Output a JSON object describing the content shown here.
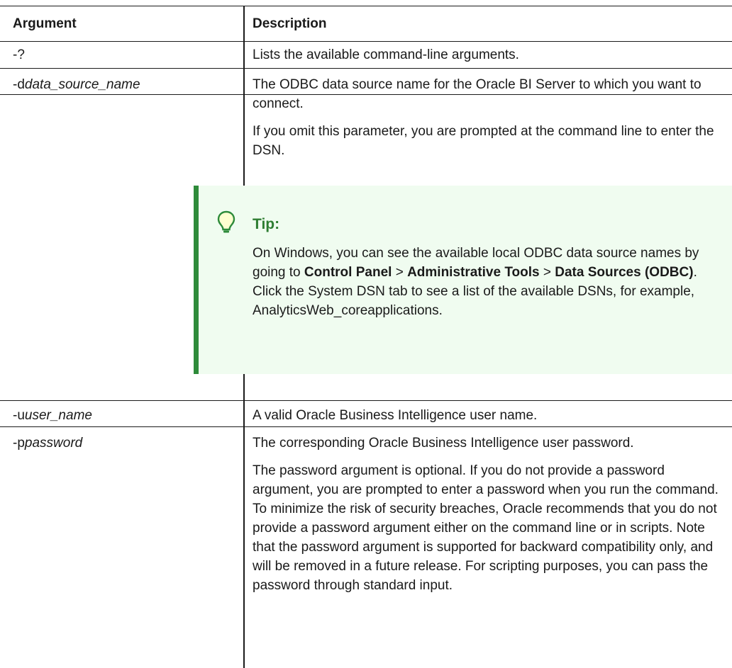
{
  "table": {
    "headers": {
      "argument": "Argument",
      "description": "Description"
    },
    "rows": [
      {
        "arg_prefix": "-?",
        "arg_italic": "",
        "desc": [
          "Lists the available command-line arguments."
        ]
      },
      {
        "arg_prefix": "-d",
        "arg_italic": "data_source_name",
        "desc": [
          "The ODBC data source name for the Oracle BI Server to which you want to connect.",
          "If you omit this parameter, you are prompted at the command line to enter the DSN."
        ]
      },
      {
        "arg_prefix": "-u",
        "arg_italic": "user_name",
        "desc": [
          "A valid Oracle Business Intelligence user name."
        ]
      },
      {
        "arg_prefix": "-p",
        "arg_italic": "password",
        "desc": [
          "The corresponding Oracle Business Intelligence user password.",
          "The password argument is optional. If you do not provide a password argument, you are prompted to enter a password when you run the command. To minimize the risk of security breaches, Oracle recommends that you do not provide a password argument either on the command line or in scripts. Note that the password argument is supported for backward compatibility only, and will be removed in a future release. For scripting purposes, you can pass the password through standard input."
        ]
      }
    ]
  },
  "tip": {
    "icon": "lightbulb-icon",
    "accent_color": "#2e8b3a",
    "background_color": "#f0fcf0",
    "title": "Tip:",
    "text_1": "On Windows, you can see the available local ODBC data source names by going to ",
    "bold_1": "Control Panel",
    "sep_1": " > ",
    "bold_2": "Administrative Tools",
    "sep_2": " > ",
    "bold_3": "Data Sources (ODBC)",
    "text_2": ". Click the System DSN tab to see a list of the available DSNs, for example, AnalyticsWeb_coreapplications."
  }
}
